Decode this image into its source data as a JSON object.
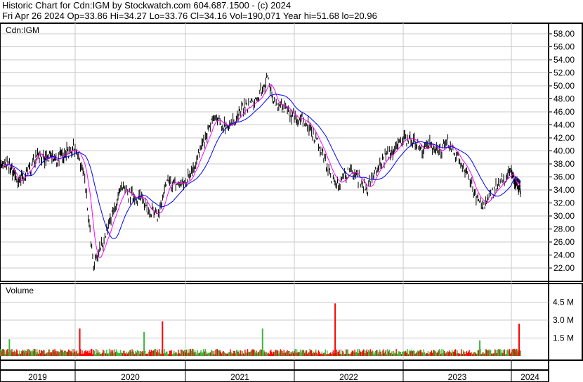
{
  "header": {
    "title": "Historic Chart for Cdn:IGM by Stockwatch.com 604.687.1500 - (c) 2024",
    "quote": "Fri Apr 26 2024   Op=33.86   Hi=34.27   Lo=33.76   Cl=34.16   Vol=190,071   Year hi=51.68   lo=20.96"
  },
  "chart_data": {
    "type": "line",
    "symbol": "Cdn:IGM",
    "volume_label": "Volume",
    "price_ticks": [
      "58.00",
      "56.00",
      "54.00",
      "52.00",
      "50.00",
      "48.00",
      "46.00",
      "44.00",
      "42.00",
      "40.00",
      "38.00",
      "36.00",
      "34.00",
      "32.00",
      "30.00",
      "28.00",
      "26.00",
      "24.00",
      "22.00"
    ],
    "price_range": [
      21,
      59
    ],
    "volume_ticks": [
      "4.5 M",
      "3.0 M",
      "1.5 M"
    ],
    "years": [
      "2019",
      "2020",
      "2021",
      "2022",
      "2023",
      "2024"
    ],
    "monthly_close": [
      37.5,
      38,
      37,
      35,
      36.5,
      37.5,
      40,
      38.5,
      39,
      38.5,
      39.5,
      40,
      40.5,
      36,
      22,
      26,
      30,
      34,
      33,
      33,
      31,
      30,
      35,
      35,
      35,
      38,
      41,
      45,
      44,
      44,
      46,
      47,
      48,
      51,
      47,
      46.5,
      45,
      45,
      43,
      40,
      36,
      35,
      37,
      36,
      34,
      37,
      39,
      40,
      42,
      42,
      40,
      41,
      40,
      41,
      39,
      37,
      33,
      31.5,
      34,
      35.5,
      36.5,
      35.5,
      35,
      34.16
    ],
    "volume_spikes": [
      {
        "month": 1,
        "vol": 1.4
      },
      {
        "month": 12,
        "vol": 2.3
      },
      {
        "month": 19,
        "vol": 2.0
      },
      {
        "month": 21,
        "vol": 2.9
      },
      {
        "month": 32,
        "vol": 2.3
      },
      {
        "month": 40,
        "vol": 4.4
      },
      {
        "month": 56,
        "vol": 1.3
      },
      {
        "month": 62,
        "vol": 2.7
      }
    ],
    "colors": {
      "price": "#000000",
      "ma_short": "#ff00ff",
      "ma_long": "#0000ff",
      "vol_up": "#3cb43c",
      "vol_down": "#ff0000"
    }
  }
}
